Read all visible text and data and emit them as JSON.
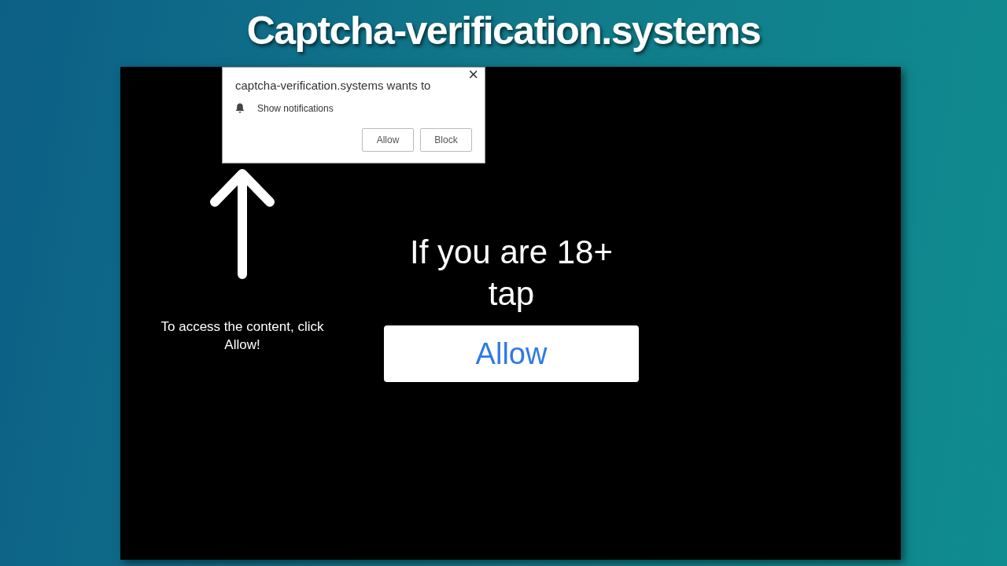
{
  "title": "Captcha-verification.systems",
  "permission_popup": {
    "origin": "captcha-verification.systems wants to",
    "permission": "Show notifications",
    "close": "×",
    "buttons": [
      {
        "label": "Allow"
      },
      {
        "label": "Block"
      }
    ]
  },
  "instruction": "To access the content, click Allow!",
  "headline": "If you are 18+ tap",
  "allow_button": "Allow"
}
